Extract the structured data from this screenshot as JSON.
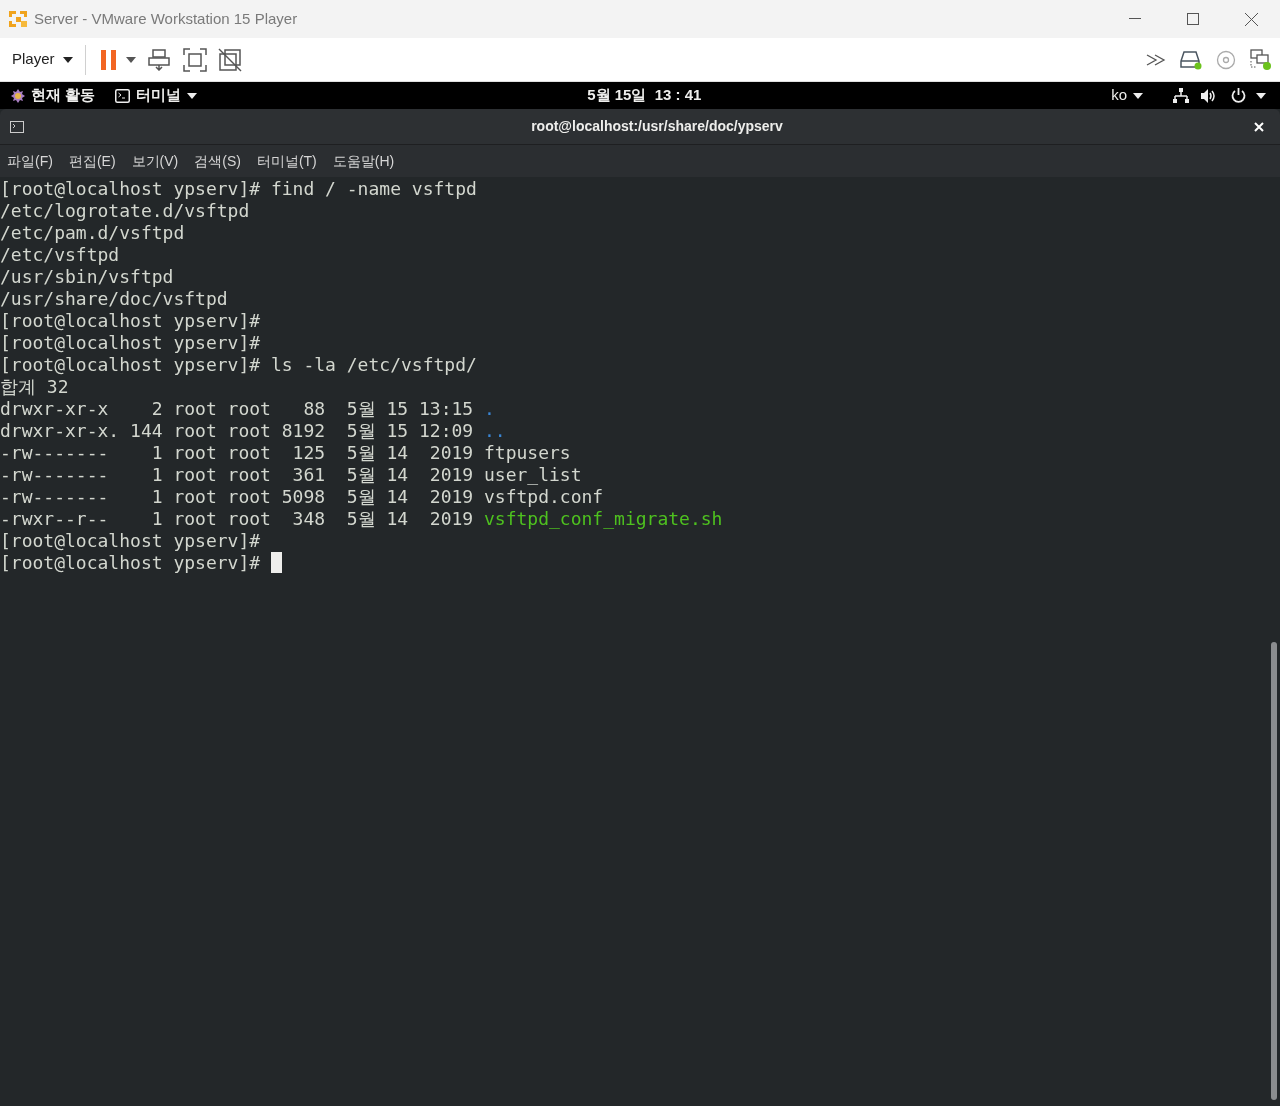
{
  "window": {
    "title": "Server - VMware Workstation 15 Player"
  },
  "toolbar": {
    "player_menu": "Player"
  },
  "gnome_bar": {
    "activities": "현재 활동",
    "app_menu": "터미널",
    "clock": "5월 15일  13 : 41",
    "input_method": "ko"
  },
  "terminal": {
    "title": "root@localhost:/usr/share/doc/ypserv",
    "menu": [
      "파일(F)",
      "편집(E)",
      "보기(V)",
      "검색(S)",
      "터미널(T)",
      "도움말(H)"
    ],
    "lines": [
      {
        "text": "[root@localhost ypserv]# find / -name vsftpd"
      },
      {
        "text": "/etc/logrotate.d/vsftpd"
      },
      {
        "text": "/etc/pam.d/vsftpd"
      },
      {
        "text": "/etc/vsftpd"
      },
      {
        "text": "/usr/sbin/vsftpd"
      },
      {
        "text": "/usr/share/doc/vsftpd"
      },
      {
        "text": "[root@localhost ypserv]#"
      },
      {
        "text": "[root@localhost ypserv]#"
      },
      {
        "text": "[root@localhost ypserv]# ls -la /etc/vsftpd/"
      },
      {
        "text": "합계 32"
      },
      {
        "text": "drwxr-xr-x    2 root root   88  5월 15 13:15 ",
        "file": {
          "name": ".",
          "kind": "directory"
        }
      },
      {
        "text": "drwxr-xr-x. 144 root root 8192  5월 15 12:09 ",
        "file": {
          "name": "..",
          "kind": "directory"
        }
      },
      {
        "text": "-rw-------    1 root root  125  5월 14  2019 ",
        "file": {
          "name": "ftpusers",
          "kind": "regular"
        }
      },
      {
        "text": "-rw-------    1 root root  361  5월 14  2019 ",
        "file": {
          "name": "user_list",
          "kind": "regular"
        }
      },
      {
        "text": "-rw-------    1 root root 5098  5월 14  2019 ",
        "file": {
          "name": "vsftpd.conf",
          "kind": "regular"
        }
      },
      {
        "text": "-rwxr--r--    1 root root  348  5월 14  2019 ",
        "file": {
          "name": "vsftpd_conf_migrate.sh",
          "kind": "executable"
        }
      },
      {
        "text": "[root@localhost ypserv]#"
      },
      {
        "text": "[root@localhost ypserv]# ",
        "cursor": true
      }
    ]
  }
}
